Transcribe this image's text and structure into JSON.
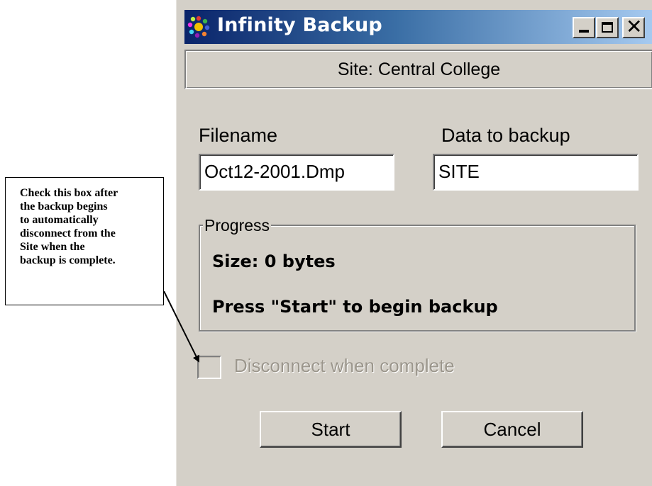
{
  "callout": {
    "lines": [
      "Check this box after",
      "the backup begins",
      "to automatically",
      "disconnect from the",
      "Site when the",
      "backup is complete."
    ]
  },
  "window": {
    "title": "Infinity Backup",
    "icon": "app-icon",
    "controls": {
      "minimize": "minimize-icon",
      "maximize": "maximize-icon",
      "close": "close-icon",
      "close_glyph": "✕"
    }
  },
  "site_header": "Site: Central College",
  "filename": {
    "label": "Filename",
    "value": "Oct12-2001.Dmp"
  },
  "data_to_backup": {
    "label": "Data to backup",
    "value": "SITE"
  },
  "progress": {
    "legend": "Progress",
    "size": "Size: 0 bytes",
    "status": "Press \"Start\" to begin backup"
  },
  "disconnect": {
    "label": "Disconnect when complete",
    "checked": false,
    "enabled": false
  },
  "buttons": {
    "start": "Start",
    "cancel": "Cancel"
  },
  "colors": {
    "face": "#d4d0c8",
    "title_start": "#0a246a",
    "title_end": "#a6caf0",
    "disabled_text": "#9b968c"
  }
}
